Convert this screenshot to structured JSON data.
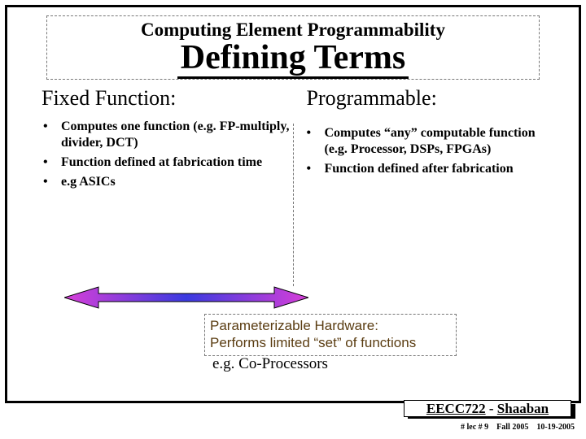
{
  "title": {
    "overline": "Computing Element Programmability",
    "main": "Defining Terms"
  },
  "left": {
    "heading": "Fixed Function:",
    "bullets": [
      "Computes one function (e.g. FP-multiply, divider, DCT)",
      "Function defined at fabrication time",
      "e.g ASICs"
    ]
  },
  "right": {
    "heading": "Programmable:",
    "bullets": [
      "Computes “any” computable function (e.g. Processor, DSPs, FPGAs)",
      "Function defined after fabrication"
    ]
  },
  "param_box": {
    "line1": "Parameterizable Hardware:",
    "line2": "Performs limited “set” of functions"
  },
  "coproc": "e.g. Co-Processors",
  "footer": {
    "course": "EECC722",
    "sep": " - ",
    "author": "Shaaban",
    "meta_lec": "#  lec # 9",
    "meta_term": "Fall 2005",
    "meta_date": "10-19-2005"
  }
}
